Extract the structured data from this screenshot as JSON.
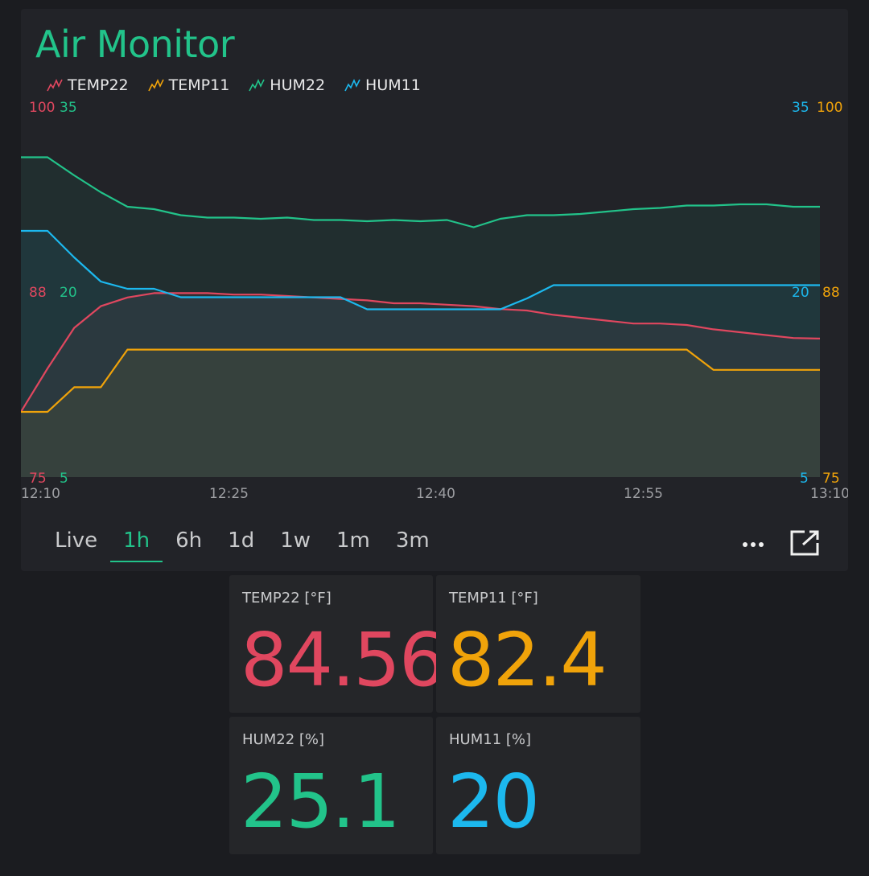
{
  "widget": {
    "title": "Air Monitor",
    "accent_color": "#22c38a"
  },
  "legend": [
    {
      "label": "TEMP22",
      "color": "#e0475f"
    },
    {
      "label": "TEMP11",
      "color": "#f0a30a"
    },
    {
      "label": "HUM22",
      "color": "#22c38a"
    },
    {
      "label": "HUM11",
      "color": "#1cb8ee"
    }
  ],
  "axes": {
    "left_temp": {
      "top": "100",
      "mid": "88",
      "bottom": "75"
    },
    "left_hum": {
      "top": "35",
      "mid": "20",
      "bottom": "5"
    },
    "right_hum": {
      "top": "35",
      "mid": "20",
      "bottom": "5"
    },
    "right_temp": {
      "top": "100",
      "mid": "88",
      "bottom": "75"
    },
    "x_ticks": [
      "12:10",
      "12:25",
      "12:40",
      "12:55",
      "13:10"
    ]
  },
  "tabs": [
    "Live",
    "1h",
    "6h",
    "1d",
    "1w",
    "1m",
    "3m"
  ],
  "active_tab": "1h",
  "icons": {
    "more": "more-dots-icon",
    "share": "share-icon"
  },
  "tiles": [
    {
      "label": "TEMP22 [°F]",
      "value": "84.56",
      "color": "#e0475f"
    },
    {
      "label": "TEMP11 [°F]",
      "value": "82.4",
      "color": "#f0a30a"
    },
    {
      "label": "HUM22 [%]",
      "value": "25.1",
      "color": "#22c38a"
    },
    {
      "label": "HUM11 [%]",
      "value": "20",
      "color": "#1cb8ee"
    }
  ],
  "chart_data": {
    "type": "line",
    "x_range": [
      "12:10",
      "13:10"
    ],
    "ylim_temp": [
      75,
      100
    ],
    "ylim_hum": [
      5,
      35
    ],
    "x_minutes": [
      0,
      2,
      4,
      6,
      8,
      10,
      12,
      14,
      16,
      18,
      20,
      22,
      24,
      26,
      28,
      30,
      32,
      34,
      36,
      38,
      40,
      42,
      44,
      46,
      48,
      50,
      52,
      54,
      56,
      58,
      60
    ],
    "series": [
      {
        "name": "TEMP22",
        "axis": "temp",
        "color": "#e0475f",
        "values": [
          79.5,
          82.5,
          85.3,
          86.8,
          87.4,
          87.7,
          87.7,
          87.7,
          87.6,
          87.6,
          87.5,
          87.4,
          87.3,
          87.2,
          87.0,
          87.0,
          86.9,
          86.8,
          86.6,
          86.5,
          86.2,
          86.0,
          85.8,
          85.6,
          85.6,
          85.5,
          85.2,
          85.0,
          84.8,
          84.6,
          84.56
        ]
      },
      {
        "name": "TEMP11",
        "axis": "temp",
        "color": "#f0a30a",
        "values": [
          79.5,
          79.5,
          81.2,
          81.2,
          83.8,
          83.8,
          83.8,
          83.8,
          83.8,
          83.8,
          83.8,
          83.8,
          83.8,
          83.8,
          83.8,
          83.8,
          83.8,
          83.8,
          83.8,
          83.8,
          83.8,
          83.8,
          83.8,
          83.8,
          83.8,
          83.8,
          82.4,
          82.4,
          82.4,
          82.4,
          82.4
        ]
      },
      {
        "name": "HUM22",
        "axis": "hum",
        "color": "#22c38a",
        "values": [
          31.5,
          31.5,
          30.0,
          28.6,
          27.4,
          27.2,
          26.7,
          26.5,
          26.5,
          26.4,
          26.5,
          26.3,
          26.3,
          26.2,
          26.3,
          26.2,
          26.3,
          25.7,
          26.4,
          26.7,
          26.7,
          26.8,
          27.0,
          27.2,
          27.3,
          27.5,
          27.5,
          27.6,
          27.6,
          27.4,
          27.4
        ]
      },
      {
        "name": "HUM11",
        "axis": "hum",
        "color": "#1cb8ee",
        "values": [
          25.4,
          25.4,
          23.2,
          21.2,
          20.6,
          20.6,
          19.9,
          19.9,
          19.9,
          19.9,
          19.9,
          19.9,
          19.9,
          18.9,
          18.9,
          18.9,
          18.9,
          18.9,
          18.9,
          19.8,
          20.9,
          20.9,
          20.9,
          20.9,
          20.9,
          20.9,
          20.9,
          20.9,
          20.9,
          20.9,
          20.9
        ]
      }
    ]
  }
}
